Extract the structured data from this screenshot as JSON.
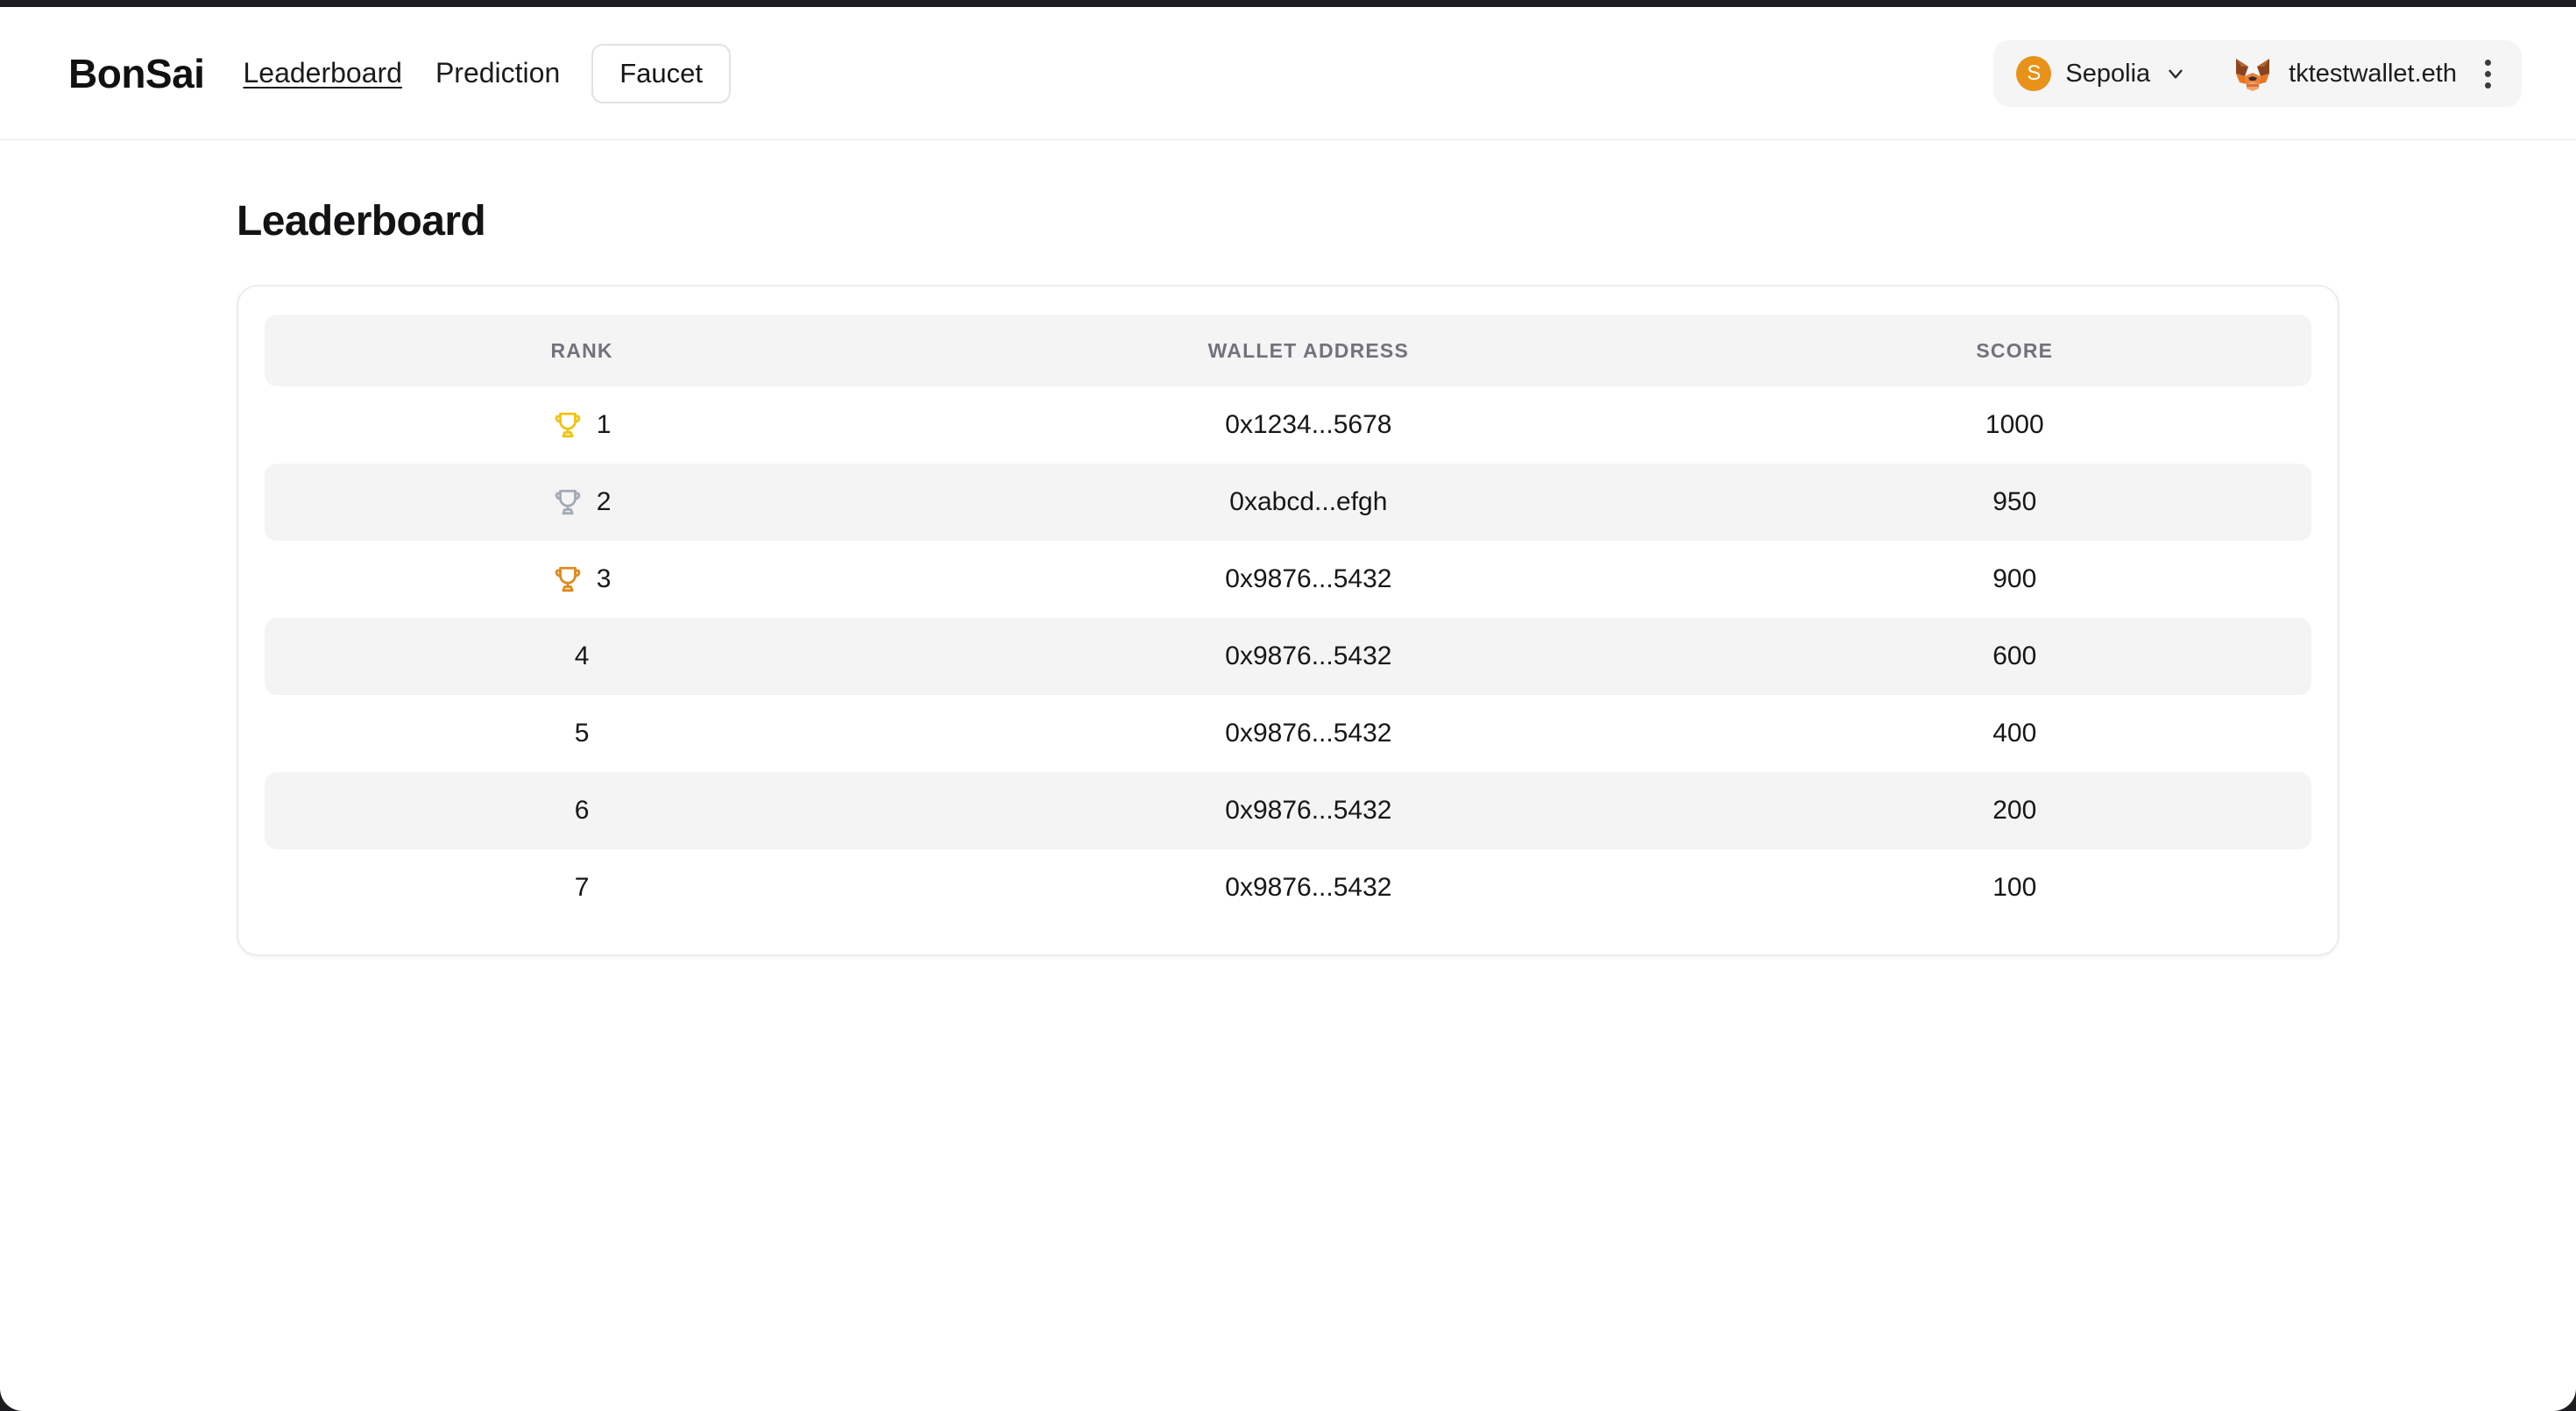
{
  "header": {
    "brand": "BonSai",
    "nav": [
      {
        "label": "Leaderboard",
        "active": true
      },
      {
        "label": "Prediction",
        "active": false
      }
    ],
    "faucet_label": "Faucet",
    "wallet": {
      "network_badge_letter": "S",
      "network_name": "Sepolia",
      "network_badge_color": "#e8921a",
      "account_name": "tktestwallet.eth",
      "wallet_icon": "metamask-fox-icon",
      "chevron_icon": "chevron-down-icon",
      "menu_icon": "vertical-dots-icon"
    }
  },
  "main": {
    "page_title": "Leaderboard",
    "table": {
      "columns": [
        "RANK",
        "WALLET ADDRESS",
        "SCORE"
      ],
      "rows": [
        {
          "rank": "1",
          "medal": "gold",
          "medal_color": "#f1c40f",
          "address": "0x1234...5678",
          "score": "1000"
        },
        {
          "rank": "2",
          "medal": "silver",
          "medal_color": "#a3aab6",
          "address": "0xabcd...efgh",
          "score": "950"
        },
        {
          "rank": "3",
          "medal": "bronze",
          "medal_color": "#df8a1c",
          "address": "0x9876...5432",
          "score": "900"
        },
        {
          "rank": "4",
          "medal": null,
          "medal_color": null,
          "address": "0x9876...5432",
          "score": "600"
        },
        {
          "rank": "5",
          "medal": null,
          "medal_color": null,
          "address": "0x9876...5432",
          "score": "400"
        },
        {
          "rank": "6",
          "medal": null,
          "medal_color": null,
          "address": "0x9876...5432",
          "score": "200"
        },
        {
          "rank": "7",
          "medal": null,
          "medal_color": null,
          "address": "0x9876...5432",
          "score": "100"
        }
      ]
    }
  }
}
